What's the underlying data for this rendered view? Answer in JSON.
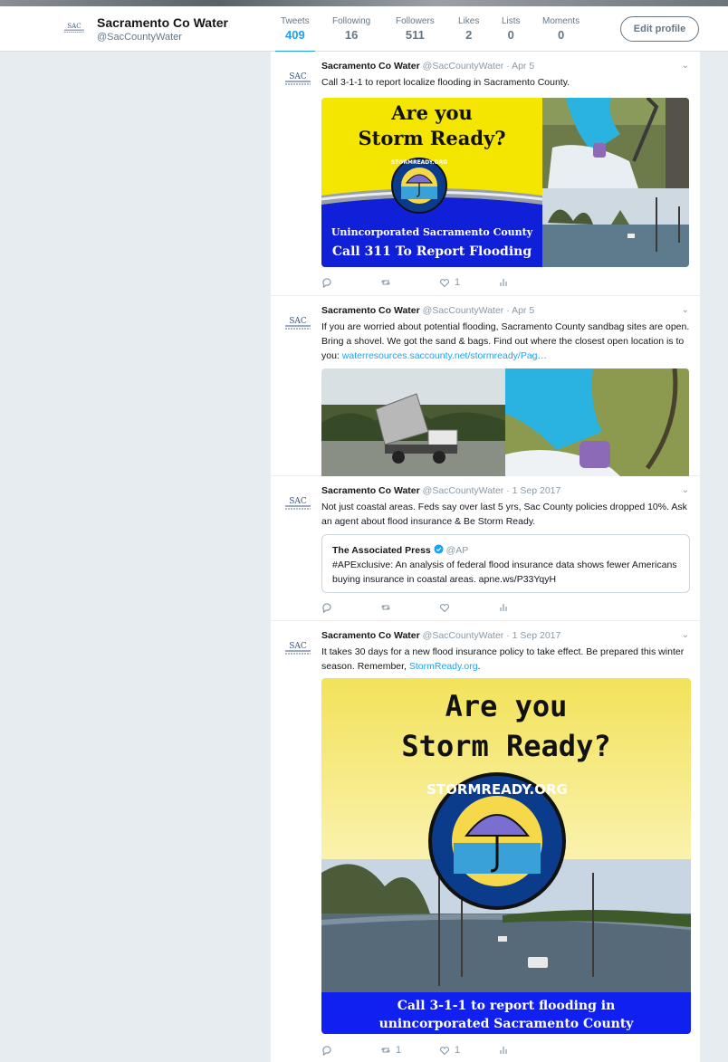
{
  "profile": {
    "name": "Sacramento Co Water",
    "handle": "@SacCountyWater",
    "stats": [
      {
        "label": "Tweets",
        "value": "409"
      },
      {
        "label": "Following",
        "value": "16"
      },
      {
        "label": "Followers",
        "value": "511"
      },
      {
        "label": "Likes",
        "value": "2"
      },
      {
        "label": "Lists",
        "value": "0"
      },
      {
        "label": "Moments",
        "value": "0"
      }
    ],
    "edit_label": "Edit profile",
    "accent": "#1da1f2"
  },
  "tweets": [
    {
      "name": "Sacramento Co Water",
      "handle": "@SacCountyWater",
      "date": "Apr 5",
      "text": "Call 3-1-1 to report localize flooding in Sacramento County.",
      "likes": "1",
      "image": {
        "line1": "Are you",
        "line2": "Storm Ready?",
        "logo": "STORMREADY.ORG",
        "caption1": "Unincorporated Sacramento County",
        "caption2": "Call 311 To Report Flooding"
      }
    },
    {
      "name": "Sacramento Co Water",
      "handle": "@SacCountyWater",
      "date": "Apr 5",
      "text": "If you are worried about potential flooding, Sacramento County sandbag sites are open. Bring a shovel. We got the sand & bags.  Find out where the closest open location is to you: ",
      "link": "waterresources.saccounty.net/stormready/Pag…"
    },
    {
      "name": "Sacramento Co Water",
      "handle": "@SacCountyWater",
      "date": "1 Sep 2017",
      "text": "Not just coastal areas. Feds say over last 5 yrs, Sac County policies dropped 10%. Ask an agent about flood insurance & Be Storm Ready.",
      "quote": {
        "name": "The Associated Press",
        "handle": "@AP",
        "text": "#APExclusive: An analysis of federal flood insurance data shows fewer Americans buying insurance in coastal areas. apne.ws/P33YqyH"
      }
    },
    {
      "name": "Sacramento Co Water",
      "handle": "@SacCountyWater",
      "date": "1 Sep 2017",
      "text": "It takes 30 days for a new flood insurance policy to take effect. Be prepared this winter season. Remember, ",
      "link": "StormReady.org",
      "text_end": ".",
      "retweets": "1",
      "likes": "1",
      "image": {
        "line1": "Are you",
        "line2": "Storm Ready?",
        "logo": "STORMREADY.ORG",
        "caption1": "Call 3-1-1 to report flooding in",
        "caption2": "unincorporated Sacramento County"
      }
    }
  ]
}
